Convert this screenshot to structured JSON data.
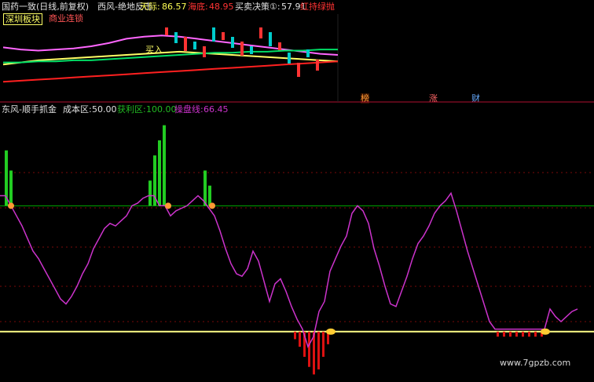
{
  "top_panel": {
    "header": {
      "stock": "国药一致(日线,前复权)",
      "indicator": "西风-绝地反击",
      "tianji_label": "天际:",
      "tianji_value": "86.57",
      "haidi_label": "海底:",
      "haidi_value": "48.95",
      "decision_label": "买卖决策①:",
      "decision_value": "57.91",
      "tail_text": "红持绿抛"
    },
    "boxes": {
      "sector": "深圳板块",
      "industry": "商业连锁"
    },
    "mark_buy": "买入",
    "badges": [
      "榜",
      "涨",
      "财"
    ]
  },
  "bottom_panel": {
    "header": {
      "indicator": "东风-顺手抓金",
      "cost_label": "成本区:",
      "cost_value": "50.00",
      "profit_label": "获利区:",
      "profit_value": "100.00",
      "control_label": "操盘线:",
      "control_value": "66.45"
    },
    "watermark": "www.7gpzb.com"
  },
  "colors": {
    "background": "#000000",
    "control_line": "#cc33cc",
    "profit_line": "#00aa00",
    "cost_line": "#ffff88",
    "green_bar": "#22cc22",
    "red_bar": "#dd1111",
    "separator": "#b01030"
  },
  "chart_data": [
    {
      "type": "line",
      "name": "top-price-panel",
      "series": [
        {
          "name": "upper-band",
          "color": "#ffff66",
          "values": [
            46,
            48,
            50,
            51,
            52,
            53,
            54,
            55,
            56,
            57,
            58,
            57,
            56,
            55,
            54,
            53,
            52,
            51,
            50,
            49
          ]
        },
        {
          "name": "middle-band",
          "color": "#ff66ff",
          "values": [
            62,
            60,
            59,
            60,
            61,
            63,
            66,
            70,
            72,
            73,
            72,
            70,
            68,
            66,
            64,
            62,
            60,
            58,
            56,
            55
          ]
        },
        {
          "name": "lower-band",
          "color": "#ff2020",
          "values": [
            30,
            31,
            32,
            33,
            34,
            35,
            36,
            37,
            38,
            39,
            40,
            41,
            42,
            43,
            44,
            45,
            46,
            47,
            48,
            49
          ]
        },
        {
          "name": "support-band",
          "color": "#00dd66",
          "values": [
            48,
            48,
            49,
            49,
            50,
            50,
            51,
            52,
            53,
            54,
            55,
            56,
            57,
            57,
            58,
            58,
            59,
            59,
            60,
            60
          ]
        }
      ],
      "ylim": [
        20,
        90
      ]
    },
    {
      "type": "line",
      "name": "bottom-oscillator-panel",
      "ylim": [
        30,
        135
      ],
      "cost": 50,
      "profit": 100,
      "x": [
        0,
        7,
        14,
        21,
        28,
        35,
        42,
        49,
        56,
        63,
        70,
        77,
        84,
        91,
        98,
        105,
        112,
        119,
        126,
        133,
        140,
        147,
        154,
        161,
        168,
        175,
        182,
        189,
        196,
        203,
        210,
        217,
        224,
        231,
        238,
        245,
        252,
        259,
        266,
        273,
        280,
        287,
        294,
        301,
        308,
        315,
        322,
        329,
        336,
        343,
        350,
        357,
        364,
        371,
        378,
        385,
        392,
        399,
        406,
        413,
        420,
        427,
        434,
        441,
        448,
        455,
        462,
        469,
        476,
        483,
        490,
        497,
        504,
        511,
        518,
        525,
        532,
        539,
        546,
        553,
        560,
        567,
        574,
        581,
        588,
        595,
        602,
        609,
        616,
        623,
        630,
        637,
        644,
        651,
        658,
        665,
        672,
        679,
        686,
        693,
        700,
        707,
        714,
        721,
        728,
        735
      ],
      "values": [
        104,
        104,
        100,
        96,
        92,
        87,
        82,
        79,
        75,
        71,
        67,
        63,
        61,
        64,
        68,
        73,
        77,
        83,
        87,
        91,
        93,
        92,
        94,
        96,
        100,
        101,
        103,
        104,
        104,
        100,
        100,
        96,
        98,
        99,
        100,
        102,
        104,
        102,
        99,
        96,
        90,
        83,
        77,
        73,
        72,
        75,
        82,
        78,
        70,
        62,
        69,
        71,
        66,
        60,
        55,
        51,
        44,
        48,
        58,
        62,
        74,
        79,
        84,
        88,
        97,
        100,
        98,
        93,
        83,
        76,
        68,
        61,
        60,
        66,
        72,
        79,
        85,
        88,
        92,
        97,
        100,
        102,
        105,
        98,
        90,
        82,
        75,
        68,
        61,
        54,
        51,
        51,
        51,
        51,
        51,
        51,
        51,
        51,
        51,
        51,
        59,
        56,
        54,
        56,
        58,
        59
      ],
      "green_bars": [
        {
          "x": 6,
          "value": 122
        },
        {
          "x": 12,
          "value": 114
        },
        {
          "x": 189,
          "value": 110
        },
        {
          "x": 195,
          "value": 120
        },
        {
          "x": 201,
          "value": 126
        },
        {
          "x": 207,
          "value": 132
        },
        {
          "x": 259,
          "value": 114
        },
        {
          "x": 265,
          "value": 108
        }
      ],
      "red_bars": [
        {
          "x": 374,
          "value": 47
        },
        {
          "x": 380,
          "value": 44
        },
        {
          "x": 386,
          "value": 40
        },
        {
          "x": 392,
          "value": 36
        },
        {
          "x": 398,
          "value": 33
        },
        {
          "x": 404,
          "value": 35
        },
        {
          "x": 410,
          "value": 40
        },
        {
          "x": 416,
          "value": 45
        },
        {
          "x": 632,
          "value": 48
        },
        {
          "x": 640,
          "value": 48
        },
        {
          "x": 648,
          "value": 48
        },
        {
          "x": 656,
          "value": 48
        },
        {
          "x": 664,
          "value": 48
        },
        {
          "x": 672,
          "value": 48
        },
        {
          "x": 680,
          "value": 48
        },
        {
          "x": 688,
          "value": 48
        }
      ]
    }
  ]
}
